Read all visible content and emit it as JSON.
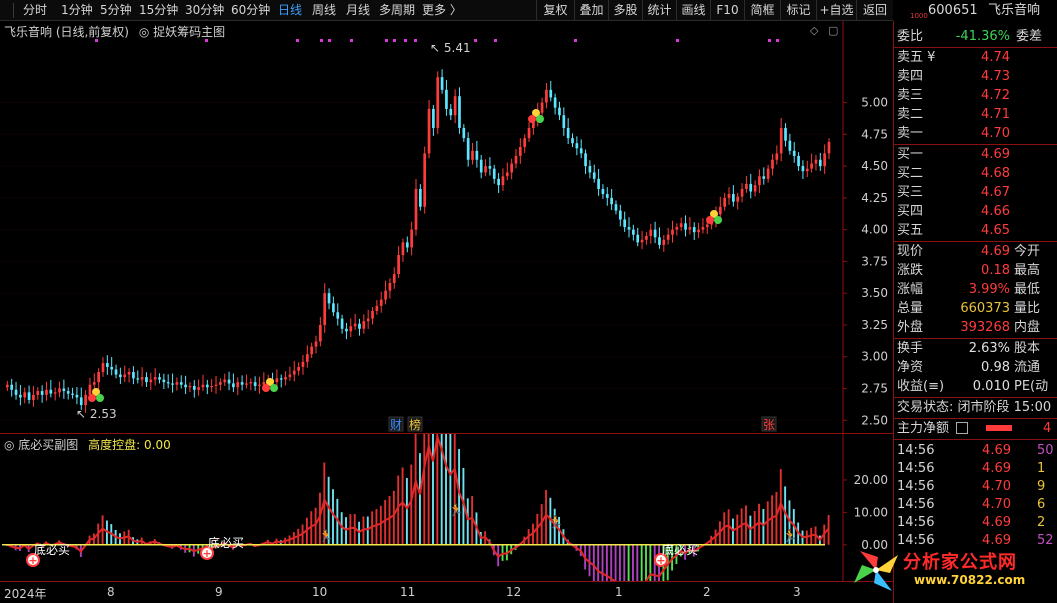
{
  "toolbar": {
    "timeframes": [
      "分时",
      "1分钟",
      "5分钟",
      "15分钟",
      "30分钟",
      "60分钟",
      "日线",
      "周线",
      "月线",
      "多周期",
      "更多 〉"
    ],
    "active_timeframe": "日线",
    "buttons": [
      "复权",
      "叠加",
      "多股",
      "统计",
      "画线",
      "F10",
      "简框",
      "标记",
      "+自选",
      "返回"
    ]
  },
  "stock": {
    "small_code": "1000",
    "code": "600651",
    "name": "飞乐音响"
  },
  "main_chart": {
    "title": "飞乐音响 (日线,前复权)",
    "indicator": "捉妖筹码主图",
    "high_label": "5.41",
    "low_label": "2.53",
    "event_tags": [
      "财",
      "榜",
      "张"
    ]
  },
  "sub_chart": {
    "title": "底必买副图",
    "control_label": "高度控盘: 0.00",
    "signal_label": "底必买",
    "y_ticks": [
      "20.00",
      "10.00",
      "0.00"
    ]
  },
  "date_axis": [
    "2024年",
    "8",
    "9",
    "10",
    "11",
    "12",
    "1",
    "2",
    "3"
  ],
  "quote": {
    "ratio_label": "委比",
    "ratio_value": "-41.36%",
    "diff_label": "委差",
    "asks": [
      {
        "label": "卖五 ¥",
        "price": "4.74"
      },
      {
        "label": "卖四",
        "price": "4.73"
      },
      {
        "label": "卖三",
        "price": "4.72"
      },
      {
        "label": "卖二",
        "price": "4.71"
      },
      {
        "label": "卖一",
        "price": "4.70"
      }
    ],
    "bids": [
      {
        "label": "买一",
        "price": "4.69"
      },
      {
        "label": "买二",
        "price": "4.68"
      },
      {
        "label": "买三",
        "price": "4.67"
      },
      {
        "label": "买四",
        "price": "4.66"
      },
      {
        "label": "买五",
        "price": "4.65"
      }
    ],
    "stats": [
      {
        "k": "现价",
        "v": "4.69",
        "c": "#ff3c3c",
        "k2": "今开"
      },
      {
        "k": "涨跌",
        "v": "0.18",
        "c": "#ff3c3c",
        "k2": "最高"
      },
      {
        "k": "涨幅",
        "v": "3.99%",
        "c": "#ff3c3c",
        "k2": "最低"
      },
      {
        "k": "总量",
        "v": "660373",
        "c": "#e8c23a",
        "k2": "量比"
      },
      {
        "k": "外盘",
        "v": "393268",
        "c": "#ff3c3c",
        "k2": "内盘"
      }
    ],
    "stats2": [
      {
        "k": "换手",
        "v": "2.63%",
        "k2": "股本"
      },
      {
        "k": "净资",
        "v": "0.98",
        "k2": "流通"
      },
      {
        "k": "收益(≡)",
        "v": "0.010",
        "k2": "PE(动"
      }
    ],
    "trade_status": "交易状态: 闭市阶段 15:00",
    "main_flow_label": "主力净额",
    "main_flow_value": "4",
    "ticks": [
      {
        "time": "14:56",
        "price": "4.69",
        "qty": "50"
      },
      {
        "time": "14:56",
        "price": "4.69",
        "qty": "1"
      },
      {
        "time": "14:56",
        "price": "4.70",
        "qty": "9"
      },
      {
        "time": "14:56",
        "price": "4.70",
        "qty": "6"
      },
      {
        "time": "14:56",
        "price": "4.69",
        "qty": "2"
      },
      {
        "time": "14:56",
        "price": "4.69",
        "qty": "52"
      }
    ]
  },
  "watermark": {
    "title": "分析家公式网",
    "url": "www.70822.com"
  },
  "chart_data": [
    {
      "type": "candlestick",
      "title": "飞乐音响 (日线,前复权)",
      "y_ticks": [
        5.0,
        4.75,
        4.5,
        4.25,
        4.0,
        3.75,
        3.5,
        3.25,
        3.0,
        2.75,
        2.5
      ],
      "ylim": [
        2.4,
        5.5
      ],
      "x_labels": [
        "2024年",
        "8",
        "9",
        "10",
        "11",
        "12",
        "1",
        "2",
        "3"
      ],
      "closes": [
        2.78,
        2.74,
        2.7,
        2.68,
        2.72,
        2.66,
        2.7,
        2.73,
        2.7,
        2.74,
        2.71,
        2.72,
        2.75,
        2.73,
        2.71,
        2.7,
        2.68,
        2.62,
        2.7,
        2.78,
        2.8,
        2.88,
        2.95,
        2.92,
        2.9,
        2.86,
        2.84,
        2.86,
        2.88,
        2.83,
        2.82,
        2.84,
        2.8,
        2.82,
        2.84,
        2.82,
        2.8,
        2.79,
        2.78,
        2.8,
        2.78,
        2.76,
        2.77,
        2.74,
        2.76,
        2.78,
        2.76,
        2.77,
        2.78,
        2.8,
        2.82,
        2.79,
        2.76,
        2.8,
        2.78,
        2.79,
        2.8,
        2.77,
        2.78,
        2.8,
        2.82,
        2.8,
        2.83,
        2.82,
        2.84,
        2.86,
        2.89,
        2.92,
        2.96,
        3.02,
        3.08,
        3.12,
        3.25,
        3.5,
        3.42,
        3.35,
        3.3,
        3.22,
        3.2,
        3.24,
        3.26,
        3.22,
        3.28,
        3.3,
        3.36,
        3.4,
        3.45,
        3.52,
        3.58,
        3.65,
        3.8,
        3.9,
        3.86,
        4.0,
        4.32,
        4.18,
        4.6,
        4.95,
        4.8,
        5.2,
        5.1,
        4.95,
        4.9,
        5.05,
        4.8,
        4.72,
        4.55,
        4.62,
        4.55,
        4.45,
        4.5,
        4.48,
        4.4,
        4.35,
        4.42,
        4.45,
        4.52,
        4.58,
        4.65,
        4.72,
        4.8,
        4.85,
        4.92,
        5.0,
        5.1,
        5.04,
        4.96,
        4.9,
        4.8,
        4.72,
        4.68,
        4.64,
        4.6,
        4.5,
        4.45,
        4.4,
        4.32,
        4.28,
        4.25,
        4.2,
        4.15,
        4.08,
        4.02,
        4.0,
        3.96,
        3.9,
        3.92,
        3.95,
        4.0,
        3.94,
        3.88,
        3.92,
        3.96,
        4.0,
        4.02,
        4.05,
        4.0,
        4.02,
        3.98,
        4.0,
        4.02,
        4.04,
        4.08,
        4.12,
        4.18,
        4.25,
        4.28,
        4.22,
        4.26,
        4.32,
        4.36,
        4.3,
        4.35,
        4.42,
        4.4,
        4.48,
        4.55,
        4.6,
        4.8,
        4.7,
        4.62,
        4.58,
        4.5,
        4.46,
        4.48,
        4.52,
        4.55,
        4.5,
        4.6,
        4.69
      ]
    },
    {
      "type": "bar",
      "title": "底必买副图",
      "y_ticks": [
        20.0,
        10.0,
        0.0
      ],
      "ylim": [
        -9,
        28
      ]
    }
  ]
}
